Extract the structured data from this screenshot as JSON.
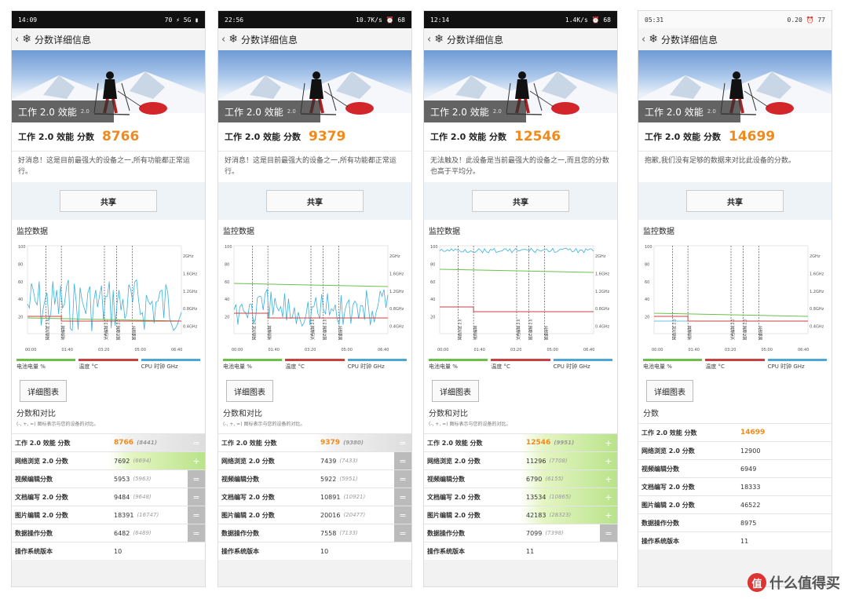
{
  "header_title": "分数详细信息",
  "hero_label": "工作 2.0 效能",
  "hero_version": "2.0",
  "score_label": "工作 2.0 效能 分数",
  "share_label": "共享",
  "monitor_title": "监控数据",
  "detail_button": "详细图表",
  "legend": [
    "电池电量 %",
    "温度 °C",
    "CPU 时钟 GHz"
  ],
  "legend_colors": [
    "#6cc04a",
    "#c94040",
    "#4aa8d8"
  ],
  "x_ticks": [
    "00:00",
    "01:40",
    "03:20",
    "05:00",
    "06:40"
  ],
  "y_ticks": [
    "100",
    "80",
    "60",
    "40",
    "20"
  ],
  "ghz_ticks": [
    "2GHz",
    "1.6GHz",
    "1.2GHz",
    "0.8GHz",
    "0.4GHz"
  ],
  "markers": [
    "网络浏览 2.0",
    "视频编辑",
    "文档编辑 2.0",
    "图片编辑 2.0",
    "数据操作"
  ],
  "hint": "(-, +, =) 图标表示与您的设备的对比。",
  "phones": [
    {
      "status": {
        "left": "14:09",
        "right": "70 ⚡ 5G ▮"
      },
      "score": "8766",
      "message": "好消息！这是目前最强大的设备之一,所有功能都正常运行。",
      "section": "分数和对比",
      "rows": [
        {
          "name": "工作 2.0 效能 分数",
          "value": "8766",
          "cmp": "(8441)",
          "sign": "=",
          "style": "eq",
          "hi": true
        },
        {
          "name": "网络浏览 2.0 分数",
          "value": "7692",
          "cmp": "(6694)",
          "sign": "+",
          "style": "pl",
          "hi": false
        },
        {
          "name": "视频编辑分数",
          "value": "5953",
          "cmp": "(5963)",
          "sign": "=",
          "style": "sm",
          "hi": false
        },
        {
          "name": "文档编写 2.0 分数",
          "value": "9484",
          "cmp": "(9648)",
          "sign": "=",
          "style": "sm",
          "hi": false
        },
        {
          "name": "图片编辑 2.0 分数",
          "value": "18391",
          "cmp": "(16747)",
          "sign": "=",
          "style": "sm",
          "hi": false
        },
        {
          "name": "数据操作分数",
          "value": "6482",
          "cmp": "(6489)",
          "sign": "=",
          "style": "sm",
          "hi": false
        },
        {
          "name": "操作系统版本",
          "value": "10",
          "cmp": "",
          "sign": "",
          "style": "",
          "hi": false
        }
      ]
    },
    {
      "status": {
        "left": "22:56",
        "right": "10.7K/s ⏰ 68"
      },
      "score": "9379",
      "message": "好消息！这是目前最强大的设备之一,所有功能都正常运行。",
      "section": "分数和对比",
      "rows": [
        {
          "name": "工作 2.0 效能 分数",
          "value": "9379",
          "cmp": "(9380)",
          "sign": "=",
          "style": "eq",
          "hi": true
        },
        {
          "name": "网络浏览 2.0 分数",
          "value": "7439",
          "cmp": "(7433)",
          "sign": "=",
          "style": "sm",
          "hi": false
        },
        {
          "name": "视频编辑分数",
          "value": "5922",
          "cmp": "(5951)",
          "sign": "=",
          "style": "sm",
          "hi": false
        },
        {
          "name": "文档编写 2.0 分数",
          "value": "10891",
          "cmp": "(10921)",
          "sign": "=",
          "style": "sm",
          "hi": false
        },
        {
          "name": "图片编辑 2.0 分数",
          "value": "20016",
          "cmp": "(20477)",
          "sign": "=",
          "style": "sm",
          "hi": false
        },
        {
          "name": "数据操作分数",
          "value": "7558",
          "cmp": "(7133)",
          "sign": "=",
          "style": "sm",
          "hi": false
        },
        {
          "name": "操作系统版本",
          "value": "10",
          "cmp": "",
          "sign": "",
          "style": "",
          "hi": false
        }
      ]
    },
    {
      "status": {
        "left": "12:14",
        "right": "1.4K/s ⏰ 68"
      },
      "score": "12546",
      "message": "无法触及！此设备是当前最强大的设备之一,而且您的分数也高于平均分。",
      "section": "分数和对比",
      "rows": [
        {
          "name": "工作 2.0 效能 分数",
          "value": "12546",
          "cmp": "(9951)",
          "sign": "+",
          "style": "pl",
          "hi": true
        },
        {
          "name": "网络浏览 2.0 分数",
          "value": "11296",
          "cmp": "(7708)",
          "sign": "+",
          "style": "pl",
          "hi": false
        },
        {
          "name": "视频编辑分数",
          "value": "6790",
          "cmp": "(6155)",
          "sign": "+",
          "style": "pl",
          "hi": false
        },
        {
          "name": "文档编写 2.0 分数",
          "value": "13534",
          "cmp": "(10865)",
          "sign": "+",
          "style": "pl",
          "hi": false
        },
        {
          "name": "图片编辑 2.0 分数",
          "value": "42183",
          "cmp": "(28323)",
          "sign": "+",
          "style": "pl",
          "hi": false
        },
        {
          "name": "数据操作分数",
          "value": "7099",
          "cmp": "(7398)",
          "sign": "=",
          "style": "sm",
          "hi": false
        },
        {
          "name": "操作系统版本",
          "value": "11",
          "cmp": "",
          "sign": "",
          "style": "",
          "hi": false
        }
      ]
    },
    {
      "status": {
        "left": "05:31",
        "right": "0.20 ⏰ 77"
      },
      "score": "14699",
      "message": "抱歉,我们没有足够的数据来对比此设备的分数。",
      "section": "分数",
      "rows": [
        {
          "name": "工作 2.0 效能 分数",
          "value": "14699",
          "cmp": "",
          "sign": "",
          "style": "",
          "hi": true
        },
        {
          "name": "网络浏览 2.0 分数",
          "value": "12900",
          "cmp": "",
          "sign": "",
          "style": "",
          "hi": false
        },
        {
          "name": "视频编辑分数",
          "value": "6949",
          "cmp": "",
          "sign": "",
          "style": "",
          "hi": false
        },
        {
          "name": "文档编写 2.0 分数",
          "value": "18333",
          "cmp": "",
          "sign": "",
          "style": "",
          "hi": false
        },
        {
          "name": "图片编辑 2.0 分数",
          "value": "46522",
          "cmp": "",
          "sign": "",
          "style": "",
          "hi": false
        },
        {
          "name": "数据操作分数",
          "value": "8975",
          "cmp": "",
          "sign": "",
          "style": "",
          "hi": false
        },
        {
          "name": "操作系统版本",
          "value": "11",
          "cmp": "",
          "sign": "",
          "style": "",
          "hi": false
        }
      ]
    }
  ],
  "watermark": "什么值得买",
  "watermark_icon": "值"
}
